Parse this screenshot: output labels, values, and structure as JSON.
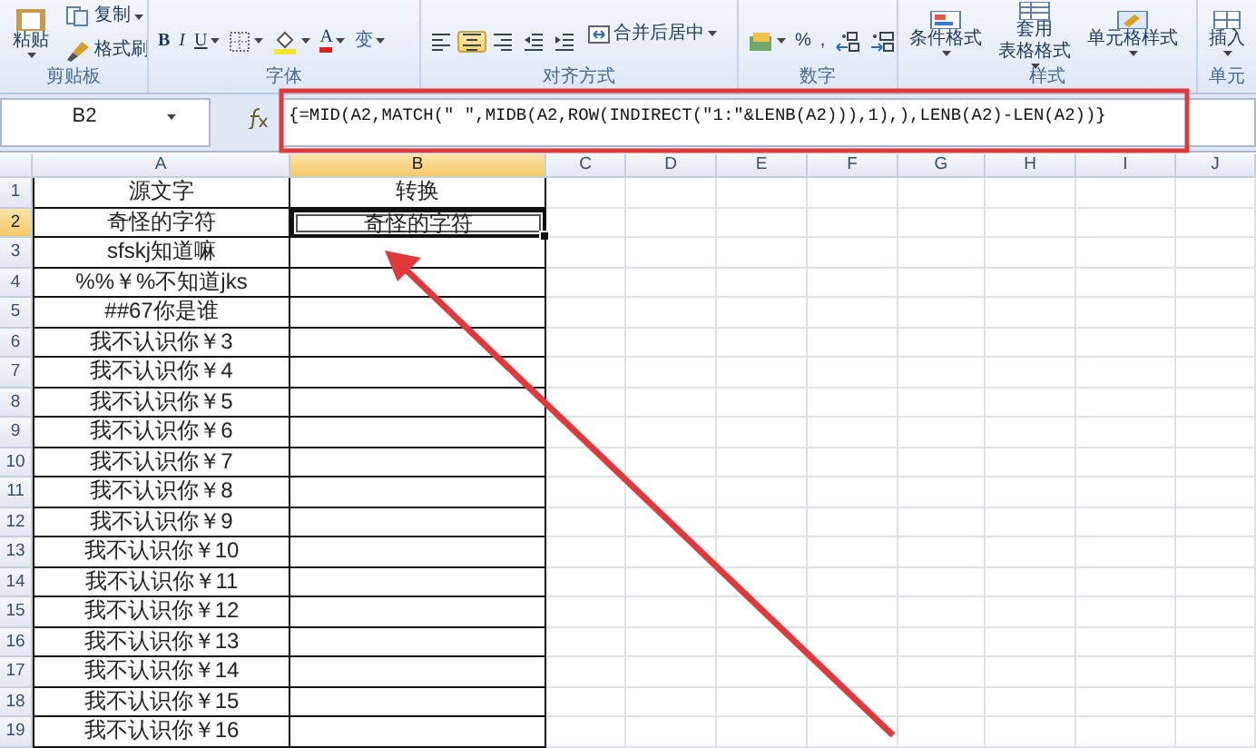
{
  "ribbon": {
    "groups": [
      {
        "label": "剪贴板",
        "columns": [
          [
            {
              "kind": "paste",
              "lines": [
                "粘贴"
              ],
              "dropdown": true
            }
          ],
          [
            {
              "kind": "copy",
              "label": "复制",
              "dropdown": true
            },
            {
              "kind": "brush",
              "label": "格式刷",
              "dropdown": false
            }
          ]
        ]
      },
      {
        "label": "字体",
        "columns": [
          [
            {
              "kind": "bold",
              "label": "B",
              "dropdown": false
            },
            {
              "kind": "italic",
              "label": "I",
              "dropdown": false
            },
            {
              "kind": "underline",
              "label": "U",
              "dropdown": true
            },
            {
              "kind": "border",
              "dropdown": true
            },
            {
              "kind": "fill",
              "dropdown": true
            },
            {
              "kind": "fontcolor",
              "label": "A",
              "dropdown": true
            },
            {
              "kind": "phonetic",
              "label": "变",
              "dropdown": true
            }
          ]
        ]
      },
      {
        "label": "对齐方式",
        "columns": [
          [
            {
              "kind": "align-left",
              "selected": false
            },
            {
              "kind": "align-center",
              "selected": true
            },
            {
              "kind": "align-right",
              "selected": false
            },
            {
              "kind": "outdent",
              "selected": false
            },
            {
              "kind": "indent",
              "selected": false
            }
          ],
          [
            {
              "kind": "merge",
              "label": "合并后居中",
              "dropdown": true
            }
          ]
        ]
      },
      {
        "label": "数字",
        "columns": [
          [
            {
              "kind": "currency",
              "dropdown": true
            },
            {
              "kind": "percent",
              "label": "%",
              "dropdown": false
            },
            {
              "kind": "comma",
              "label": ",",
              "dropdown": false
            },
            {
              "kind": "more-decimal",
              "dropdown": false
            },
            {
              "kind": "less-decimal",
              "dropdown": false
            }
          ]
        ]
      },
      {
        "label": "样式",
        "columns": [
          [
            {
              "kind": "conditional",
              "lines": [
                "条件格式"
              ],
              "dropdown": true
            }
          ],
          [
            {
              "kind": "table-format",
              "lines": [
                "套用",
                "表格格式"
              ],
              "dropdown": true
            }
          ],
          [
            {
              "kind": "cell-style",
              "lines": [
                "单元格样式"
              ],
              "dropdown": true
            }
          ]
        ]
      },
      {
        "label": "单元",
        "columns": [
          [
            {
              "kind": "insert",
              "lines": [
                "插入"
              ],
              "dropdown": true
            }
          ]
        ]
      }
    ]
  },
  "formula_bar": {
    "name_box": "B2",
    "formula": "{=MID(A2,MATCH(\" \",MIDB(A2,ROW(INDIRECT(\"1:\"&LENB(A2))),1),),LENB(A2)-LEN(A2))}"
  },
  "sheet": {
    "columns": [
      {
        "label": "A",
        "selected": false
      },
      {
        "label": "B",
        "selected": true
      },
      {
        "label": "C",
        "selected": false
      },
      {
        "label": "D",
        "selected": false
      },
      {
        "label": "E",
        "selected": false
      },
      {
        "label": "F",
        "selected": false
      },
      {
        "label": "G",
        "selected": false
      },
      {
        "label": "H",
        "selected": false
      },
      {
        "label": "I",
        "selected": false
      },
      {
        "label": "J",
        "selected": false
      }
    ],
    "rows": [
      {
        "number": "1",
        "selected": false,
        "cells": [
          {
            "text": "源文字",
            "selected": false
          },
          {
            "text": "转换",
            "selected": false
          }
        ]
      },
      {
        "number": "2",
        "selected": true,
        "cells": [
          {
            "text": "奇怪的字符",
            "selected": false
          },
          {
            "text": "奇怪的字符",
            "selected": true
          }
        ]
      },
      {
        "number": "3",
        "selected": false,
        "cells": [
          {
            "text": "sfskj知道嘛",
            "selected": false
          },
          {
            "selected": false
          }
        ]
      },
      {
        "number": "4",
        "selected": false,
        "cells": [
          {
            "text": "%%￥%不知道jks",
            "selected": false
          },
          {
            "selected": false
          }
        ]
      },
      {
        "number": "5",
        "selected": false,
        "cells": [
          {
            "text": "##67你是谁",
            "selected": false
          },
          {
            "selected": false
          }
        ]
      },
      {
        "number": "6",
        "selected": false,
        "cells": [
          {
            "text": "我不认识你￥3",
            "selected": false
          },
          {
            "selected": false
          }
        ]
      },
      {
        "number": "7",
        "selected": false,
        "cells": [
          {
            "text": "我不认识你￥4",
            "selected": false
          },
          {
            "selected": false
          }
        ]
      },
      {
        "number": "8",
        "selected": false,
        "cells": [
          {
            "text": "我不认识你￥5",
            "selected": false
          },
          {
            "selected": false
          }
        ]
      },
      {
        "number": "9",
        "selected": false,
        "cells": [
          {
            "text": "我不认识你￥6",
            "selected": false
          },
          {
            "selected": false
          }
        ]
      },
      {
        "number": "10",
        "selected": false,
        "cells": [
          {
            "text": "我不认识你￥7",
            "selected": false
          },
          {
            "selected": false
          }
        ]
      },
      {
        "number": "11",
        "selected": false,
        "cells": [
          {
            "text": "我不认识你￥8",
            "selected": false
          },
          {
            "selected": false
          }
        ]
      },
      {
        "number": "12",
        "selected": false,
        "cells": [
          {
            "text": "我不认识你￥9",
            "selected": false
          },
          {
            "selected": false
          }
        ]
      },
      {
        "number": "13",
        "selected": false,
        "cells": [
          {
            "text": "我不认识你￥10",
            "selected": false
          },
          {
            "selected": false
          }
        ]
      },
      {
        "number": "14",
        "selected": false,
        "cells": [
          {
            "text": "我不认识你￥11",
            "selected": false
          },
          {
            "selected": false
          }
        ]
      },
      {
        "number": "15",
        "selected": false,
        "cells": [
          {
            "text": "我不认识你￥12",
            "selected": false
          },
          {
            "selected": false
          }
        ]
      },
      {
        "number": "16",
        "selected": false,
        "cells": [
          {
            "text": "我不认识你￥13",
            "selected": false
          },
          {
            "selected": false
          }
        ]
      },
      {
        "number": "17",
        "selected": false,
        "cells": [
          {
            "text": "我不认识你￥14",
            "selected": false
          },
          {
            "selected": false
          }
        ]
      },
      {
        "number": "18",
        "selected": false,
        "cells": [
          {
            "text": "我不认识你￥15",
            "selected": false
          },
          {
            "selected": false
          }
        ]
      },
      {
        "number": "19",
        "selected": false,
        "cells": [
          {
            "text": "我不认识你￥16",
            "selected": false
          },
          {
            "selected": false
          }
        ]
      }
    ]
  },
  "highlight_frame": {
    "color": "#e0383b"
  },
  "arrow": {
    "color": "#e0383b"
  }
}
